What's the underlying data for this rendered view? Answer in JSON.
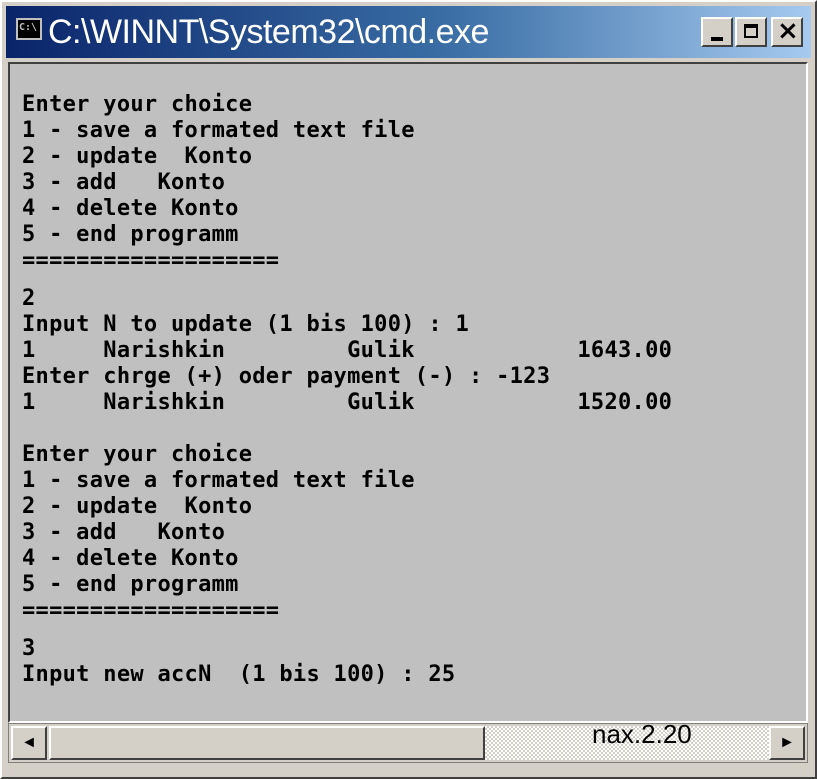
{
  "window": {
    "title": "C:\\WINNT\\System32\\cmd.exe",
    "icon": "cmd-icon",
    "icon_text": "C:\\"
  },
  "caption_buttons": {
    "minimize": "minimize-icon",
    "maximize": "maximize-icon",
    "close": "close-icon",
    "close_glyph": "×"
  },
  "console": {
    "background": "#c0c0c0",
    "text_color": "#000000",
    "lines": [
      "",
      "Enter your choice",
      "1 - save a formated text file",
      "2 - update  Konto",
      "3 - add   Konto",
      "4 - delete Konto",
      "5 - end programm",
      "===================",
      "",
      "2",
      "Input N to update (1 bis 100) : 1",
      "1     Narishkin         Gulik            1643.00",
      "Enter chrge (+) oder payment (-) : -123",
      "1     Narishkin         Gulik            1520.00",
      "",
      "Enter your choice",
      "1 - save a formated text file",
      "2 - update  Konto",
      "3 - add   Konto",
      "4 - delete Konto",
      "5 - end programm",
      "===================",
      "",
      "3",
      "Input new accN  (1 bis 100) : 25"
    ]
  },
  "scrollbar": {
    "left_arrow": "◄",
    "right_arrow": "►"
  },
  "watermark": "nax.2.20",
  "colors": {
    "titlebar_start": "#0a246a",
    "titlebar_end": "#a6caf0",
    "chrome": "#d4d0c8"
  }
}
